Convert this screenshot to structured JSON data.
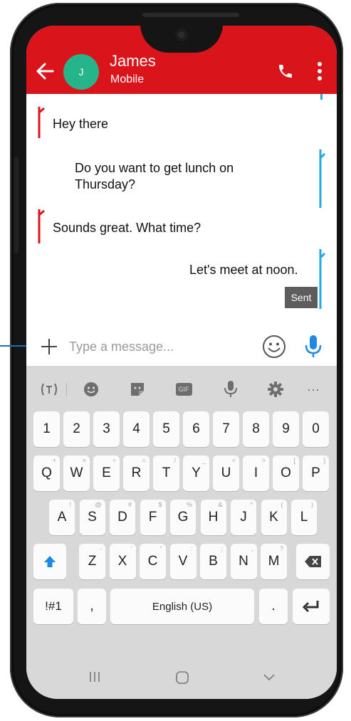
{
  "header": {
    "contact_name": "James",
    "contact_subtitle": "Mobile",
    "avatar_initial": "J",
    "colors": {
      "bar": "#d9141b",
      "avatar": "#26b58a"
    },
    "icons": [
      "back-arrow-icon",
      "phone-icon",
      "more-vert-icon"
    ]
  },
  "conversation": {
    "messages": [
      {
        "direction": "incoming",
        "text": "Hey there"
      },
      {
        "direction": "outgoing",
        "text": "Do you want to get lunch on Thursday?"
      },
      {
        "direction": "incoming",
        "text": "Sounds great. What time?"
      },
      {
        "direction": "outgoing",
        "text": "Let's meet at noon.",
        "status": "Sent"
      }
    ],
    "colors": {
      "incoming_mark": "#e0121b",
      "outgoing_mark": "#29a7e1"
    }
  },
  "compose": {
    "placeholder": "Type a message...",
    "icons": [
      "plus-icon",
      "emoji-icon",
      "mic-icon"
    ]
  },
  "keyboard": {
    "toolbar": [
      "text-correction-icon",
      "emoji-icon",
      "sticker-icon",
      "gif-icon",
      "voice-input-icon",
      "settings-icon",
      "more-icon"
    ],
    "gif_label": "GIF",
    "number_row": [
      "1",
      "2",
      "3",
      "4",
      "5",
      "6",
      "7",
      "8",
      "9",
      "0"
    ],
    "row1": [
      "Q",
      "W",
      "E",
      "R",
      "T",
      "Y",
      "U",
      "I",
      "O",
      "P"
    ],
    "row1_hints": [
      "+",
      "×",
      "÷",
      "=",
      "/",
      "_",
      "<",
      ">",
      "[",
      "]"
    ],
    "row2": [
      "A",
      "S",
      "D",
      "F",
      "G",
      "H",
      "J",
      "K",
      "L"
    ],
    "row2_hints": [
      "!",
      "@",
      "#",
      "$",
      "%",
      "&",
      "*",
      "(",
      ")"
    ],
    "row3": [
      "Z",
      "X",
      "C",
      "V",
      "B",
      "N",
      "M"
    ],
    "row3_hints": [
      "-",
      "'",
      "\"",
      ":",
      ";",
      ",",
      "?"
    ],
    "symbols_label": "!#1",
    "comma_label": ",",
    "space_label": "English (US)",
    "period_label": ".",
    "icons": [
      "shift-icon",
      "backspace-icon",
      "enter-icon"
    ]
  },
  "navigation": {
    "icons": [
      "recent-apps-icon",
      "home-icon",
      "back-chevron-icon"
    ]
  }
}
